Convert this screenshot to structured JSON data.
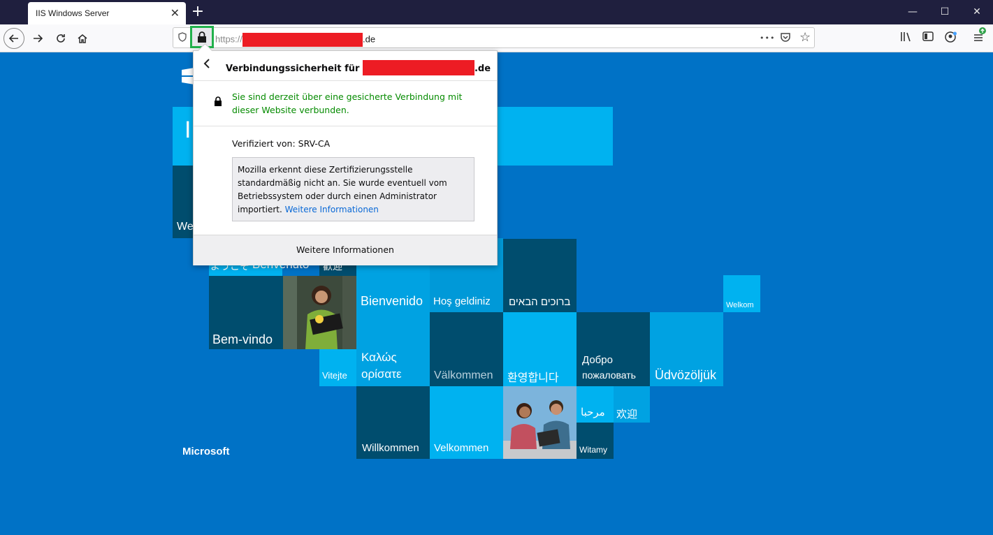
{
  "browser": {
    "tab_title": "IIS Windows Server",
    "tab_close": "✕",
    "new_tab": "+",
    "window_controls": {
      "minimize": "—",
      "maximize": "☐",
      "close": "✕"
    }
  },
  "navbar": {
    "back_icon": "arrow-left-icon",
    "forward_icon": "arrow-right-icon",
    "reload_icon": "reload-icon",
    "home_icon": "home-icon",
    "url_scheme": "https://",
    "url_domain_suffix": ".de",
    "page_actions": {
      "more": "•••",
      "pocket": "pocket-icon",
      "bookmark": "☆"
    },
    "toolbar_icons": [
      "library-icon",
      "sidebar-icon",
      "account-icon",
      "menu-icon"
    ]
  },
  "popup": {
    "header": "Verbindungssicherheit für",
    "header_suffix": ".de",
    "secure_status": "Sie sind derzeit über eine gesicherte Verbindung mit dieser Website verbunden.",
    "verified_by": "Verifiziert von: SRV-CA",
    "warning_text": "Mozilla erkennt diese Zertifizierungsstelle standardmäßig nicht an. Sie wurde eventuell vom Betriebssystem oder durch einen Administrator importiert.",
    "warning_link": "Weitere Informationen",
    "footer_button": "Weitere Informationen"
  },
  "page": {
    "heading_partial": "I",
    "welcome_partial": "We",
    "microsoft_logo": "Microsoft",
    "tiles": {
      "youkoso": "ようこそ",
      "benvenuto": "Benvenuto",
      "kangei": "歡迎",
      "bem_vindo": "Bem-vindo",
      "bienvenido": "Bienvenido",
      "hos_geldiniz": "Hoş geldiniz",
      "hebrew": "ברוכים הבאים",
      "welkom": "Welkom",
      "vitejte": "Vitejte",
      "greek_1": "Καλώς",
      "greek_2": "ορίσατε",
      "valkommen": "Välkommen",
      "korean": "환영합니다",
      "russian_1": "Добро",
      "russian_2": "пожаловать",
      "udvozoljuk": "Üdvözöljük",
      "willkommen": "Willkommen",
      "velkommen": "Velkommen",
      "arabic": "مرحبا",
      "huanying": "欢迎",
      "witamy": "Witamy"
    }
  },
  "colors": {
    "page_bg": "#0072c6",
    "tile_light": "#00b2f0",
    "tile_dark": "#004d6e",
    "secure_green": "#058b00",
    "highlight_box": "#22b14c",
    "redaction": "#ed1c24"
  }
}
